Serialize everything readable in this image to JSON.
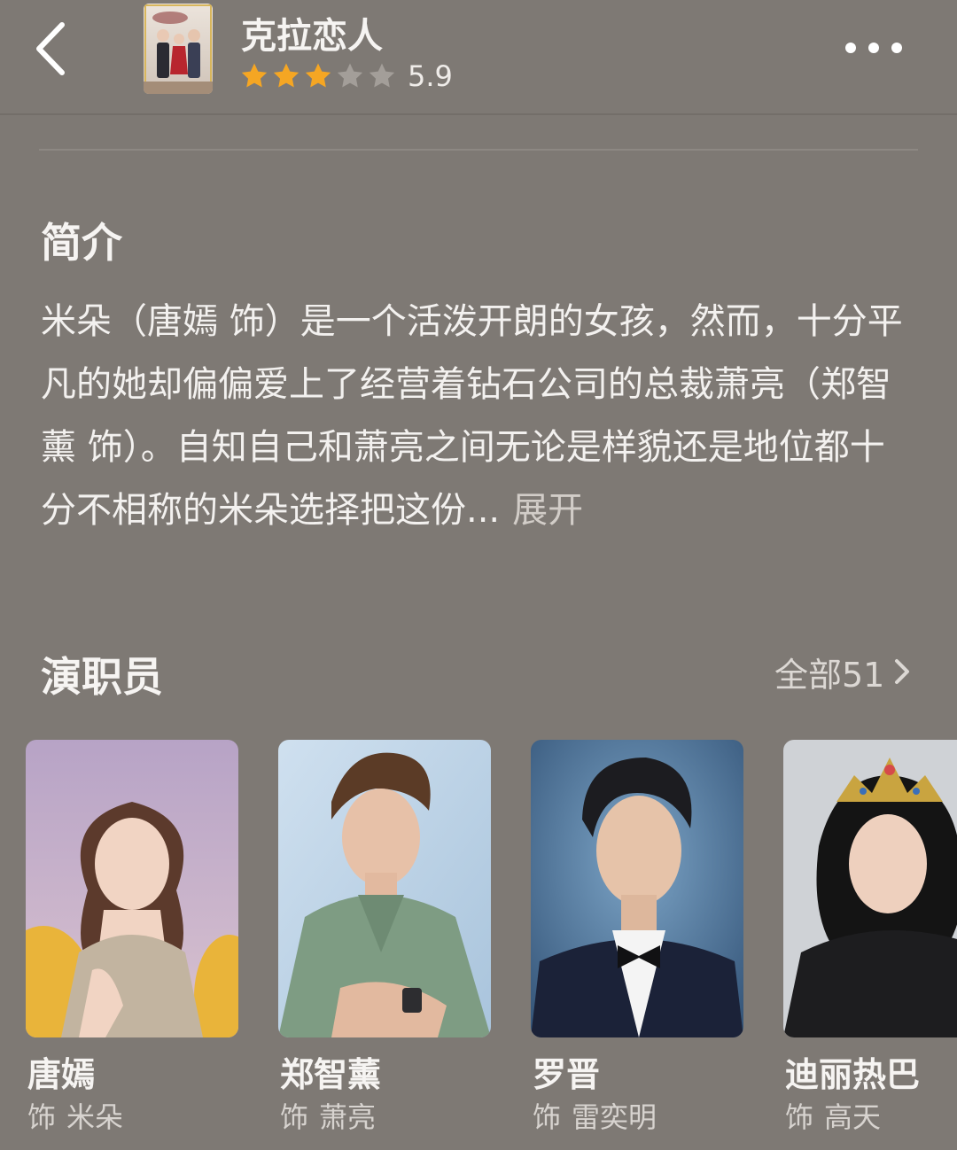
{
  "header": {
    "title": "克拉恋人",
    "rating": {
      "score": "5.9",
      "stars_filled": 3,
      "stars_total": 5
    }
  },
  "synopsis": {
    "heading": "简介",
    "text": "米朵（唐嫣 饰）是一个活泼开朗的女孩，然而，十分平凡的她却偏偏爱上了经营着钻石公司的总裁萧亮（郑智薰 饰）。自知自己和萧亮之间无论是样貌还是地位都十分不相称的米朵选择把这份...",
    "expand_label": "展开"
  },
  "cast": {
    "heading": "演职员",
    "see_all_label": "全部51",
    "role_prefix": "饰",
    "members": [
      {
        "name": "唐嫣",
        "role": "米朵"
      },
      {
        "name": "郑智薰",
        "role": "萧亮"
      },
      {
        "name": "罗晋",
        "role": "雷奕明"
      },
      {
        "name": "迪丽热巴",
        "role": "高天"
      }
    ]
  },
  "colors": {
    "background": "#7e7974",
    "star_filled": "#f5a623",
    "star_empty": "#a39e99",
    "text_primary": "#f6f4f2",
    "text_secondary": "#d7d3cf"
  },
  "icons": {
    "back": "chevron-left-icon",
    "more": "more-dots-icon",
    "see_all": "chevron-right-icon",
    "star": "star-icon"
  }
}
